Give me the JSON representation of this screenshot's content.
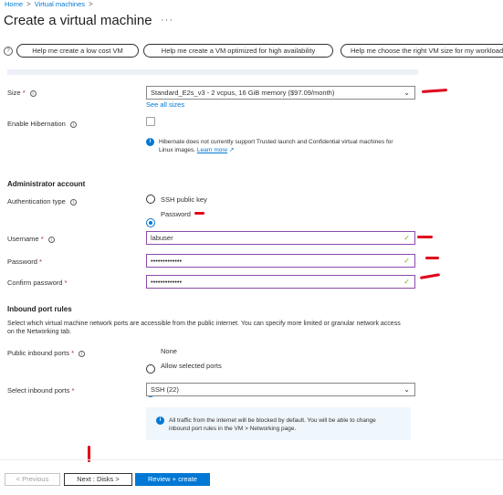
{
  "breadcrumb": {
    "home": "Home",
    "sep1": ">",
    "vms": "Virtual machines",
    "sep2": ">"
  },
  "title": "Create a virtual machine",
  "more": "···",
  "help": {
    "icon": "?",
    "low_cost": "Help me create a low cost VM",
    "high_avail": "Help me create a VM optimized for high availability",
    "right_size": "Help me choose the right VM size for my workload"
  },
  "size": {
    "label": "Size",
    "required": "*",
    "value": "Standard_E2s_v3 - 2 vcpus, 16 GiB memory ($97.09/month)",
    "see_all": "See all sizes"
  },
  "hibernation": {
    "label": "Enable Hibernation",
    "note": "Hibernate does not currently support Trusted launch and Confidential virtual machines for Linux images.",
    "learn_more": "Learn more"
  },
  "admin": {
    "title": "Administrator account",
    "auth_label": "Authentication type",
    "ssh_label": "SSH public key",
    "password_label": "Password",
    "username_label": "Username",
    "username_value": "labuser",
    "password_field_label": "Password",
    "password_value": "•••••••••••••",
    "confirm_label": "Confirm password",
    "confirm_value": "•••••••••••••"
  },
  "inbound": {
    "title": "Inbound port rules",
    "desc": "Select which virtual machine network ports are accessible from the public internet. You can specify more limited or granular network access on the Networking tab.",
    "public_label": "Public inbound ports",
    "none_label": "None",
    "allow_label": "Allow selected ports",
    "select_label": "Select inbound ports",
    "select_value": "SSH (22)",
    "note": "All traffic from the internet will be blocked by default. You will be able to change inbound port rules in the VM > Networking page."
  },
  "footer": {
    "previous": "< Previous",
    "next": "Next : Disks >",
    "review": "Review + create"
  },
  "colors": {
    "accent": "#0078d4",
    "annotation": "#e0001a",
    "success": "#6bb700"
  }
}
